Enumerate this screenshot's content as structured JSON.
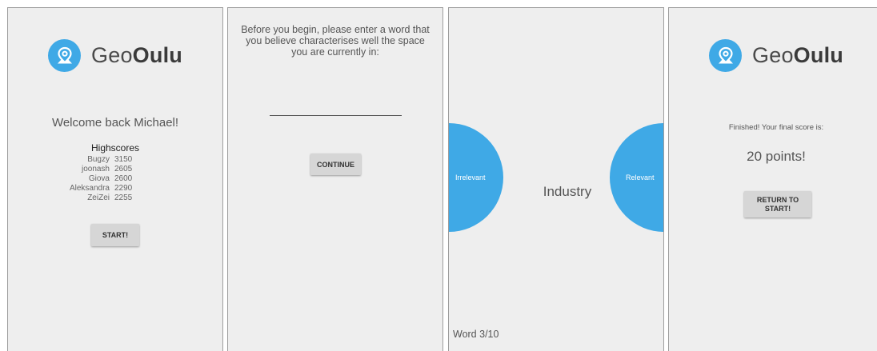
{
  "screen1": {
    "logo": {
      "prefix": "Geo",
      "bold": "Oulu",
      "icon": "map-pin-icon"
    },
    "welcome": "Welcome back Michael!",
    "highscores_title": "Highscores",
    "highscores": [
      {
        "name": "Bugzy",
        "score": "3150"
      },
      {
        "name": "joonash",
        "score": "2605"
      },
      {
        "name": "Giova",
        "score": "2600"
      },
      {
        "name": "Aleksandra",
        "score": "2290"
      },
      {
        "name": "ZeiZei",
        "score": "2255"
      }
    ],
    "start_label": "START!"
  },
  "screen2": {
    "prompt": "Before you begin, please enter a word that you believe characterises well the space you are currently in:",
    "input_value": "",
    "continue_label": "CONTINUE"
  },
  "screen3": {
    "irrelevant_label": "Irrelevant",
    "relevant_label": "Relevant",
    "word": "Industry",
    "progress": "Word 3/10"
  },
  "screen4": {
    "logo": {
      "prefix": "Geo",
      "bold": "Oulu",
      "icon": "map-pin-icon"
    },
    "finished": "Finished! Your final score is:",
    "score": "20 points!",
    "return_label": "RETURN TO START!"
  },
  "colors": {
    "accent": "#3fa9e6",
    "screen_bg": "#eeeeee",
    "button_bg": "#d6d6d6"
  }
}
